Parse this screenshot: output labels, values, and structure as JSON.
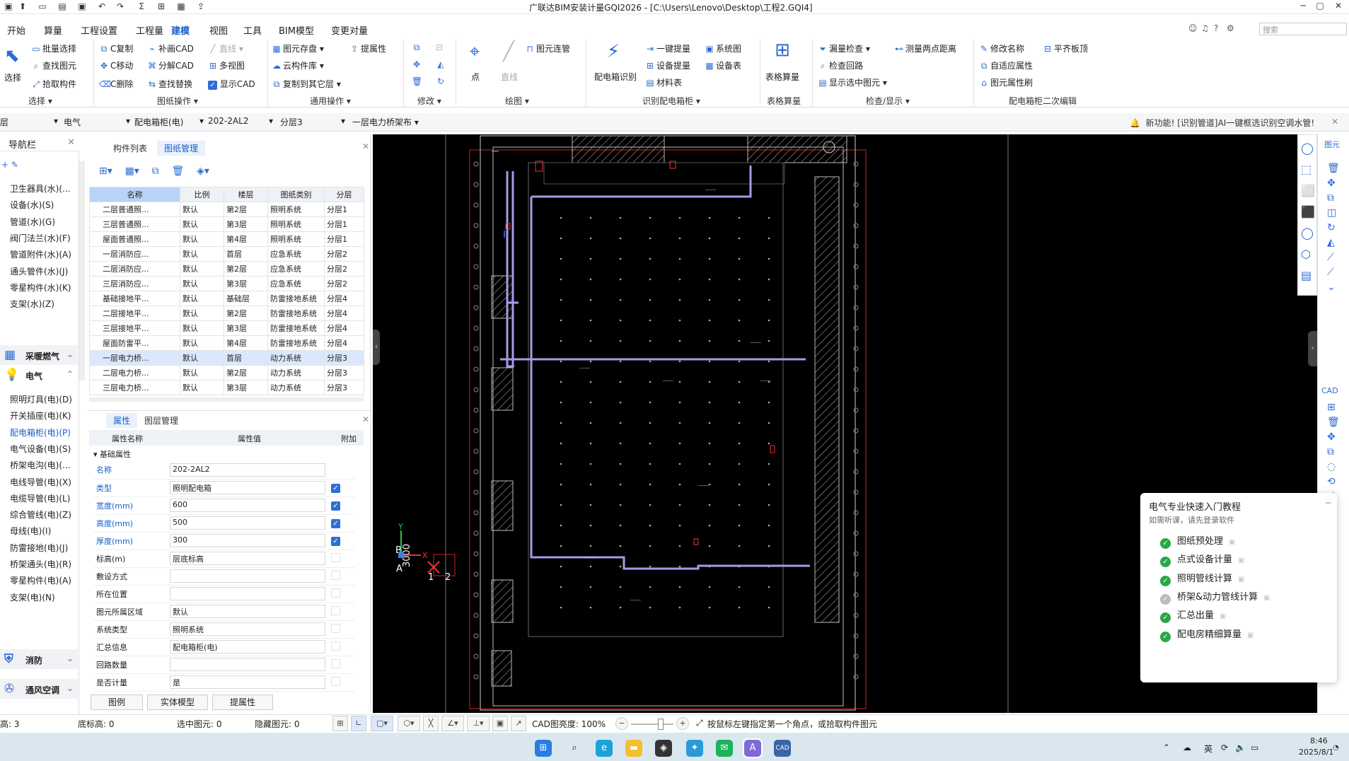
{
  "title_bar": {
    "title": "广联达BIM安装计量GQI2026 - [C:\\Users\\Lenovo\\Desktop\\工程2.GQI4]",
    "min": "─",
    "max": "▢",
    "close": "✕"
  },
  "menu": [
    "开始",
    "算量",
    "工程设置",
    "工程量",
    "建模",
    "视图",
    "工具",
    "BIM模型",
    "变更对量"
  ],
  "search": {
    "placeholder": "搜索"
  },
  "ribbon": {
    "select": "选择",
    "batch_select": "批量选择",
    "find_element": "查找图元",
    "pick_component": "拾取构件",
    "copy": "C复制",
    "move": "C移动",
    "delete": "C删除",
    "add_cad": "补画CAD",
    "split_cad": "分解CAD",
    "find_replace": "查找替换",
    "line": "直线",
    "multi_view": "多视图",
    "show_cad": "显示CAD",
    "save_elem": "图元存盘",
    "cloud_lib": "云构件库",
    "copy_layer": "复制到其它层",
    "pick_attr": "提属性",
    "point": "点",
    "line2": "直线",
    "elem_pipe": "图元连管",
    "dist_recog": "配电箱识别",
    "one_key": "一键提量",
    "equip_extract": "设备提量",
    "material": "材料表",
    "system_diag": "系统图",
    "equip_table": "设备表",
    "table_calc": "表格算量",
    "leak_check": "漏量检查",
    "check_loop": "检查回路",
    "show_selected": "显示选中图元",
    "measure": "测量两点距离",
    "rename": "修改名称",
    "adapt_attr": "自适应属性",
    "brush_attr": "图元属性刷",
    "flat_board": "平齐板顶",
    "groups": {
      "select": "选择",
      "drawing": "图纸操作",
      "common": "通用操作",
      "modify": "修改",
      "draw": "绘图",
      "recog": "识别配电箱柜",
      "table": "表格算量",
      "check": "检查/显示",
      "edit2": "配电箱柜二次编辑"
    }
  },
  "filter": {
    "layer": "层",
    "discipline": "电气",
    "type": "配电箱柜(电)",
    "item": "202-2AL2",
    "sublayer": "分层3",
    "drawing": "一层电力桥架布"
  },
  "notice": "新功能! [识别管道]AI一键框选识别空调水管!",
  "nav": {
    "title": "导航栏",
    "water_items": [
      "卫生器具(水)(...",
      "设备(水)(S)",
      "管道(水)(G)",
      "阀门法兰(水)(F)",
      "管道附件(水)(A)",
      "通头管件(水)(J)",
      "零星构件(水)(K)",
      "支架(水)(Z)"
    ],
    "cat_heating": "采暖燃气",
    "cat_electric": "电气",
    "electric_items": [
      "照明灯具(电)(D)",
      "开关插座(电)(K)",
      "配电箱柜(电)(P)",
      "电气设备(电)(S)",
      "桥架电沟(电)(...",
      "电线导管(电)(X)",
      "电缆导管(电)(L)",
      "综合管线(电)(Z)",
      "母线(电)(I)",
      "防雷接地(电)(J)",
      "桥架通头(电)(R)",
      "零星构件(电)(A)",
      "支架(电)(N)"
    ],
    "cat_fire": "消防",
    "cat_hvac": "通风空调"
  },
  "panel": {
    "tab_components": "构件列表",
    "tab_drawings": "图纸管理",
    "columns": [
      "名称",
      "比例",
      "楼层",
      "图纸类别",
      "分层"
    ],
    "rows": [
      [
        "二层普通照...",
        "默认",
        "第2层",
        "照明系统",
        "分层1"
      ],
      [
        "三层普通照...",
        "默认",
        "第3层",
        "照明系统",
        "分层1"
      ],
      [
        "屋面普通照...",
        "默认",
        "第4层",
        "照明系统",
        "分层1"
      ],
      [
        "一层消防应...",
        "默认",
        "首层",
        "应急系统",
        "分层2"
      ],
      [
        "二层消防应...",
        "默认",
        "第2层",
        "应急系统",
        "分层2"
      ],
      [
        "三层消防应...",
        "默认",
        "第3层",
        "应急系统",
        "分层2"
      ],
      [
        "基础接地平...",
        "默认",
        "基础层",
        "防雷接地系统",
        "分层4"
      ],
      [
        "二层接地平...",
        "默认",
        "第2层",
        "防雷接地系统",
        "分层4"
      ],
      [
        "三层接地平...",
        "默认",
        "第3层",
        "防雷接地系统",
        "分层4"
      ],
      [
        "屋面防雷平...",
        "默认",
        "第4层",
        "防雷接地系统",
        "分层4"
      ],
      [
        "一层电力桥...",
        "默认",
        "首层",
        "动力系统",
        "分层3"
      ],
      [
        "二层电力桥...",
        "默认",
        "第2层",
        "动力系统",
        "分层3"
      ],
      [
        "三层电力桥...",
        "默认",
        "第3层",
        "动力系统",
        "分层3"
      ]
    ],
    "tab_props": "属性",
    "tab_layers": "图层管理",
    "prop_cols": [
      "属性名称",
      "属性值",
      "附加"
    ],
    "prop_group": "基础属性",
    "props": [
      {
        "name": "名称",
        "value": "202-2AL2",
        "blue": true,
        "chk": ""
      },
      {
        "name": "类型",
        "value": "照明配电箱",
        "blue": true,
        "chk": "on"
      },
      {
        "name": "宽度(mm)",
        "value": "600",
        "blue": true,
        "chk": "on"
      },
      {
        "name": "高度(mm)",
        "value": "500",
        "blue": true,
        "chk": "on"
      },
      {
        "name": "厚度(mm)",
        "value": "300",
        "blue": true,
        "chk": "on"
      },
      {
        "name": "标高(m)",
        "value": "层底标高",
        "blue": false,
        "chk": "off"
      },
      {
        "name": "敷设方式",
        "value": "",
        "blue": false,
        "chk": "off"
      },
      {
        "name": "所在位置",
        "value": "",
        "blue": false,
        "chk": "off"
      },
      {
        "name": "图元所属区域",
        "value": "默认",
        "blue": false,
        "chk": "off"
      },
      {
        "name": "系统类型",
        "value": "照明系统",
        "blue": false,
        "chk": "off"
      },
      {
        "name": "汇总信息",
        "value": "配电箱柜(电)",
        "blue": false,
        "chk": "off"
      },
      {
        "name": "回路数量",
        "value": "",
        "blue": false,
        "chk": "off"
      },
      {
        "name": "是否计量",
        "value": "是",
        "blue": false,
        "chk": "off"
      }
    ],
    "bottom_btns": [
      "图例",
      "实体模型",
      "提属性"
    ]
  },
  "canvas": {
    "label_b": "B",
    "label_a": "A",
    "dim": "3000",
    "n1": "1",
    "n2": "2",
    "axis_x": "X",
    "axis_y": "Y"
  },
  "right_tools": {
    "top_label": "图元",
    "cad_label": "CAD"
  },
  "tutorial": {
    "title": "电气专业快速入门教程",
    "sub": "如需听课，请先登录软件",
    "items": [
      {
        "label": "图纸预处理",
        "done": true
      },
      {
        "label": "点式设备计量",
        "done": true
      },
      {
        "label": "照明管线计算",
        "done": true
      },
      {
        "label": "桥架&动力管线计算",
        "done": false
      },
      {
        "label": "汇总出量",
        "done": true
      },
      {
        "label": "配电房精细算量",
        "done": true
      }
    ]
  },
  "status": {
    "floor_height": "高: 3",
    "bottom_height": "底标高: 0",
    "selected": "选中图元: 0",
    "hidden": "隐藏图元: 0",
    "cad_brightness": "CAD图亮度: 100%",
    "hint": "按鼠标左键指定第一个角点，或拾取构件图元"
  },
  "taskbar": {
    "ime": "英",
    "time": "8:46",
    "date": "2025/8/1"
  },
  "colors": {
    "accent": "#1a5ec8",
    "purple_line": "#a79ae8",
    "canvas_bg": "#000000",
    "check_green": "#27a844"
  }
}
